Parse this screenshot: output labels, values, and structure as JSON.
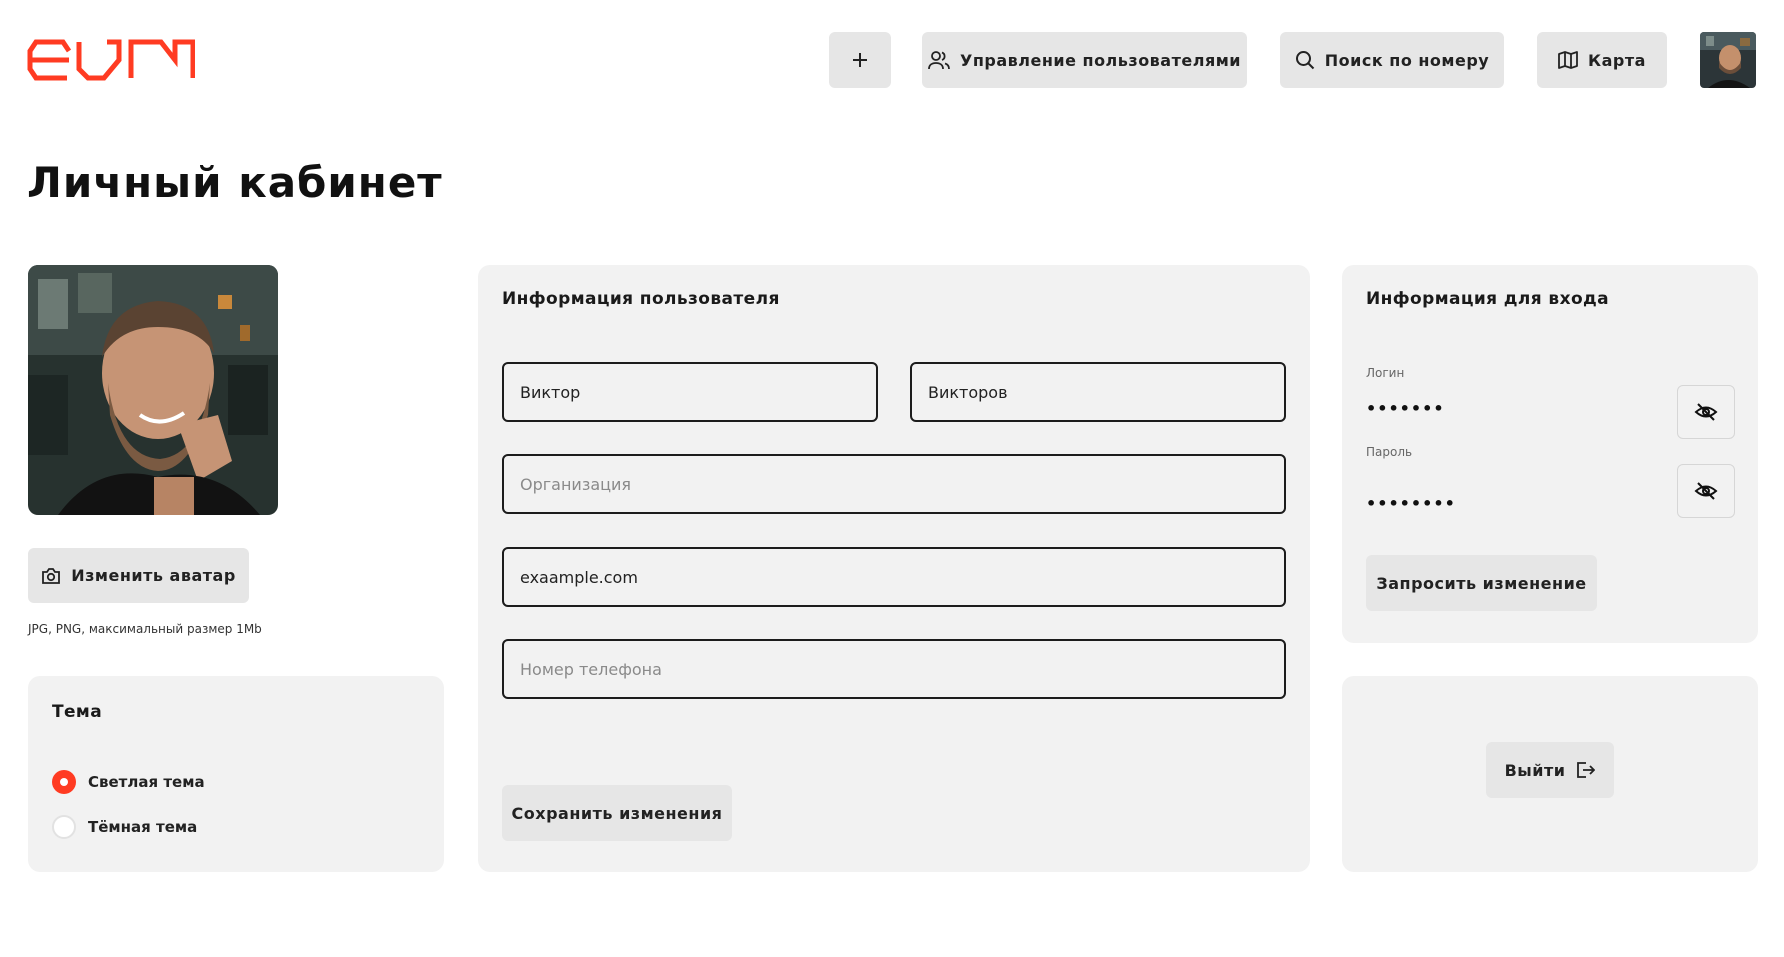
{
  "brand": {
    "logo_text": "evm",
    "accent_color": "#ff3b22"
  },
  "header": {
    "add_button": {
      "icon": "plus-icon"
    },
    "users_button": {
      "label": "Управление пользователями",
      "icon": "users-icon"
    },
    "search_button": {
      "label": "Поиск по номеру",
      "icon": "search-icon"
    },
    "map_button": {
      "label": "Карта",
      "icon": "map-icon"
    },
    "avatar": {
      "icon": "user-avatar-photo"
    }
  },
  "page": {
    "title": "Личный кабинет"
  },
  "avatar_section": {
    "change_label": "Изменить аватар",
    "hint": "JPG, PNG, максимальный размер 1Mb"
  },
  "theme": {
    "title": "Тема",
    "options": [
      {
        "label": "Светлая тема",
        "selected": true
      },
      {
        "label": "Тёмная тема",
        "selected": false
      }
    ]
  },
  "user_info": {
    "title": "Информация пользователя",
    "first_name": {
      "value": "Виктор",
      "placeholder": ""
    },
    "last_name": {
      "value": "Викторов",
      "placeholder": ""
    },
    "organization": {
      "value": "",
      "placeholder": "Организация"
    },
    "email": {
      "value": "exaample.com",
      "placeholder": ""
    },
    "phone": {
      "value": "",
      "placeholder": "Номер телефона"
    },
    "save_label": "Сохранить изменения"
  },
  "login_info": {
    "title": "Информация для входа",
    "login_label": "Логин",
    "login_masked": "•••••••",
    "password_label": "Пароль",
    "password_masked": "••••••••",
    "request_label": "Запросить изменение"
  },
  "logout": {
    "label": "Выйти",
    "icon": "logout-icon"
  }
}
